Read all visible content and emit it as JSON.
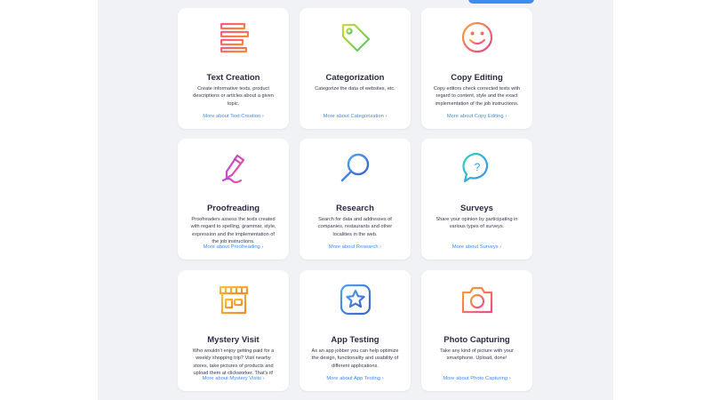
{
  "colors": {
    "accent": "#3b8ef0",
    "panel": "#f1f2f6",
    "title": "#2a2c44"
  },
  "cards": [
    {
      "icon": "text-lines-icon",
      "title": "Text Creation",
      "description": "Create informative texts, product descriptions or articles about a given topic.",
      "link": "More about Text Creation ›"
    },
    {
      "icon": "tag-icon",
      "title": "Categorization",
      "description": "Categorize the data of websites, etc.",
      "link": "More about Categorization ›"
    },
    {
      "icon": "smiley-icon",
      "title": "Copy Editing",
      "description": "Copy editors check corrected texts with regard to content, style and the exact implementation of the job instructions.",
      "link": "More about Copy Editing ›"
    },
    {
      "icon": "pen-icon",
      "title": "Proofreading",
      "description": "Proofreaders assess the texts created with regard to spelling, grammar, style, expression and the implementation of the job instructions.",
      "link": "More about Proofreading ›"
    },
    {
      "icon": "magnifier-icon",
      "title": "Research",
      "description": "Search for data and addresses of companies, restaurants and other localities in the web.",
      "link": "More about Research ›"
    },
    {
      "icon": "question-bubble-icon",
      "title": "Surveys",
      "description": "Share your opinion by participating in various types of surveys.",
      "link": "More about Surveys ›"
    },
    {
      "icon": "storefront-icon",
      "title": "Mystery Visit",
      "description": "Who wouldn't enjoy getting paid for a weekly shopping trip? Visit nearby stores, take pictures of products and upload them at clickworker. That's it!",
      "link": "More about Mystery Visits ›"
    },
    {
      "icon": "app-star-icon",
      "title": "App Testing",
      "description": "As an app jobber you can help optimize the design, functionality and usability of different applications.",
      "link": "More about App Testing ›"
    },
    {
      "icon": "camera-icon",
      "title": "Photo Capturing",
      "description": "Take any kind of picture with your smartphone. Upload, done!",
      "link": "More about Photo Capturing ›"
    }
  ]
}
